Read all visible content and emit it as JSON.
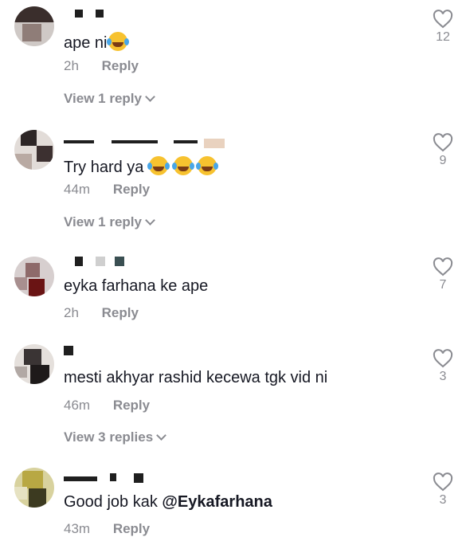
{
  "comments": [
    {
      "text": "ape ni",
      "emoji_count": 1,
      "time": "2h",
      "reply_label": "Reply",
      "likes": "12",
      "view_replies": "View 1 reply"
    },
    {
      "text": "Try hard ya",
      "emoji_count": 3,
      "time": "44m",
      "reply_label": "Reply",
      "likes": "9",
      "view_replies": "View 1 reply"
    },
    {
      "text": "eyka farhana ke ape",
      "emoji_count": 0,
      "time": "2h",
      "reply_label": "Reply",
      "likes": "7",
      "view_replies": ""
    },
    {
      "text": "mesti akhyar rashid kecewa tgk vid ni",
      "emoji_count": 0,
      "time": "46m",
      "reply_label": "Reply",
      "likes": "3",
      "view_replies": "View 3 replies"
    },
    {
      "text_prefix": "Good job kak ",
      "mention": "@Eykafarhana",
      "emoji_count": 0,
      "time": "43m",
      "reply_label": "Reply",
      "likes": "3",
      "view_replies": ""
    }
  ],
  "colors": {
    "text": "#161823",
    "muted": "#8a8b91",
    "background": "#ffffff"
  },
  "icons": {
    "like": "heart-outline-icon",
    "expand": "chevron-down-icon",
    "emoji": "laughing-crying-emoji-icon"
  }
}
